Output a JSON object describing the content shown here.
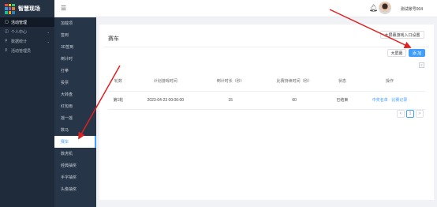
{
  "brand": {
    "name": "智慧现场",
    "logo_colors": [
      "#e74c3c",
      "#f1c40f",
      "#2ecc71",
      "#3498db",
      "#9b59b6",
      "#e67e22",
      "#1abc9c",
      "#f39c12",
      "#2980b9"
    ]
  },
  "topbar": {
    "username": "测试账号004"
  },
  "primary_nav": [
    {
      "label": "活动管理",
      "icon": "doc-icon",
      "active": true
    },
    {
      "label": "个人中心",
      "icon": "user-icon",
      "active": false,
      "expandable": true
    },
    {
      "label": "数据统计",
      "icon": "chart-icon",
      "active": false,
      "expandable": true
    },
    {
      "label": "活动管理员",
      "icon": "admin-icon",
      "active": false
    }
  ],
  "secondary_nav": [
    "加载项",
    "签到",
    "3D签到",
    "倒计时",
    "打拳",
    "投票",
    "大转盘",
    "红包雨",
    "摇一摇",
    "数马",
    "赛车",
    "数虎机",
    "经典抽奖",
    "手字抽奖",
    "头像抽奖"
  ],
  "secondary_active_index": 10,
  "card": {
    "title": "赛车",
    "entry_button": "大屏幕游戏入口设置",
    "screen_button": "大屏幕",
    "add_button": "添 加"
  },
  "table": {
    "headers": [
      "轮数",
      "计划游戏时间",
      "倒计时长（秒）",
      "比赛持续时间（秒）",
      "状态",
      "操作"
    ],
    "rows": [
      {
        "round": "第1轮",
        "time": "2023-04-23 00:00:00",
        "countdown": "15",
        "duration": "60",
        "status": "已结束",
        "ops": "中奖名单 · 比赛记录"
      }
    ]
  },
  "pager": {
    "prev": "<",
    "current": "1",
    "next": ">"
  }
}
